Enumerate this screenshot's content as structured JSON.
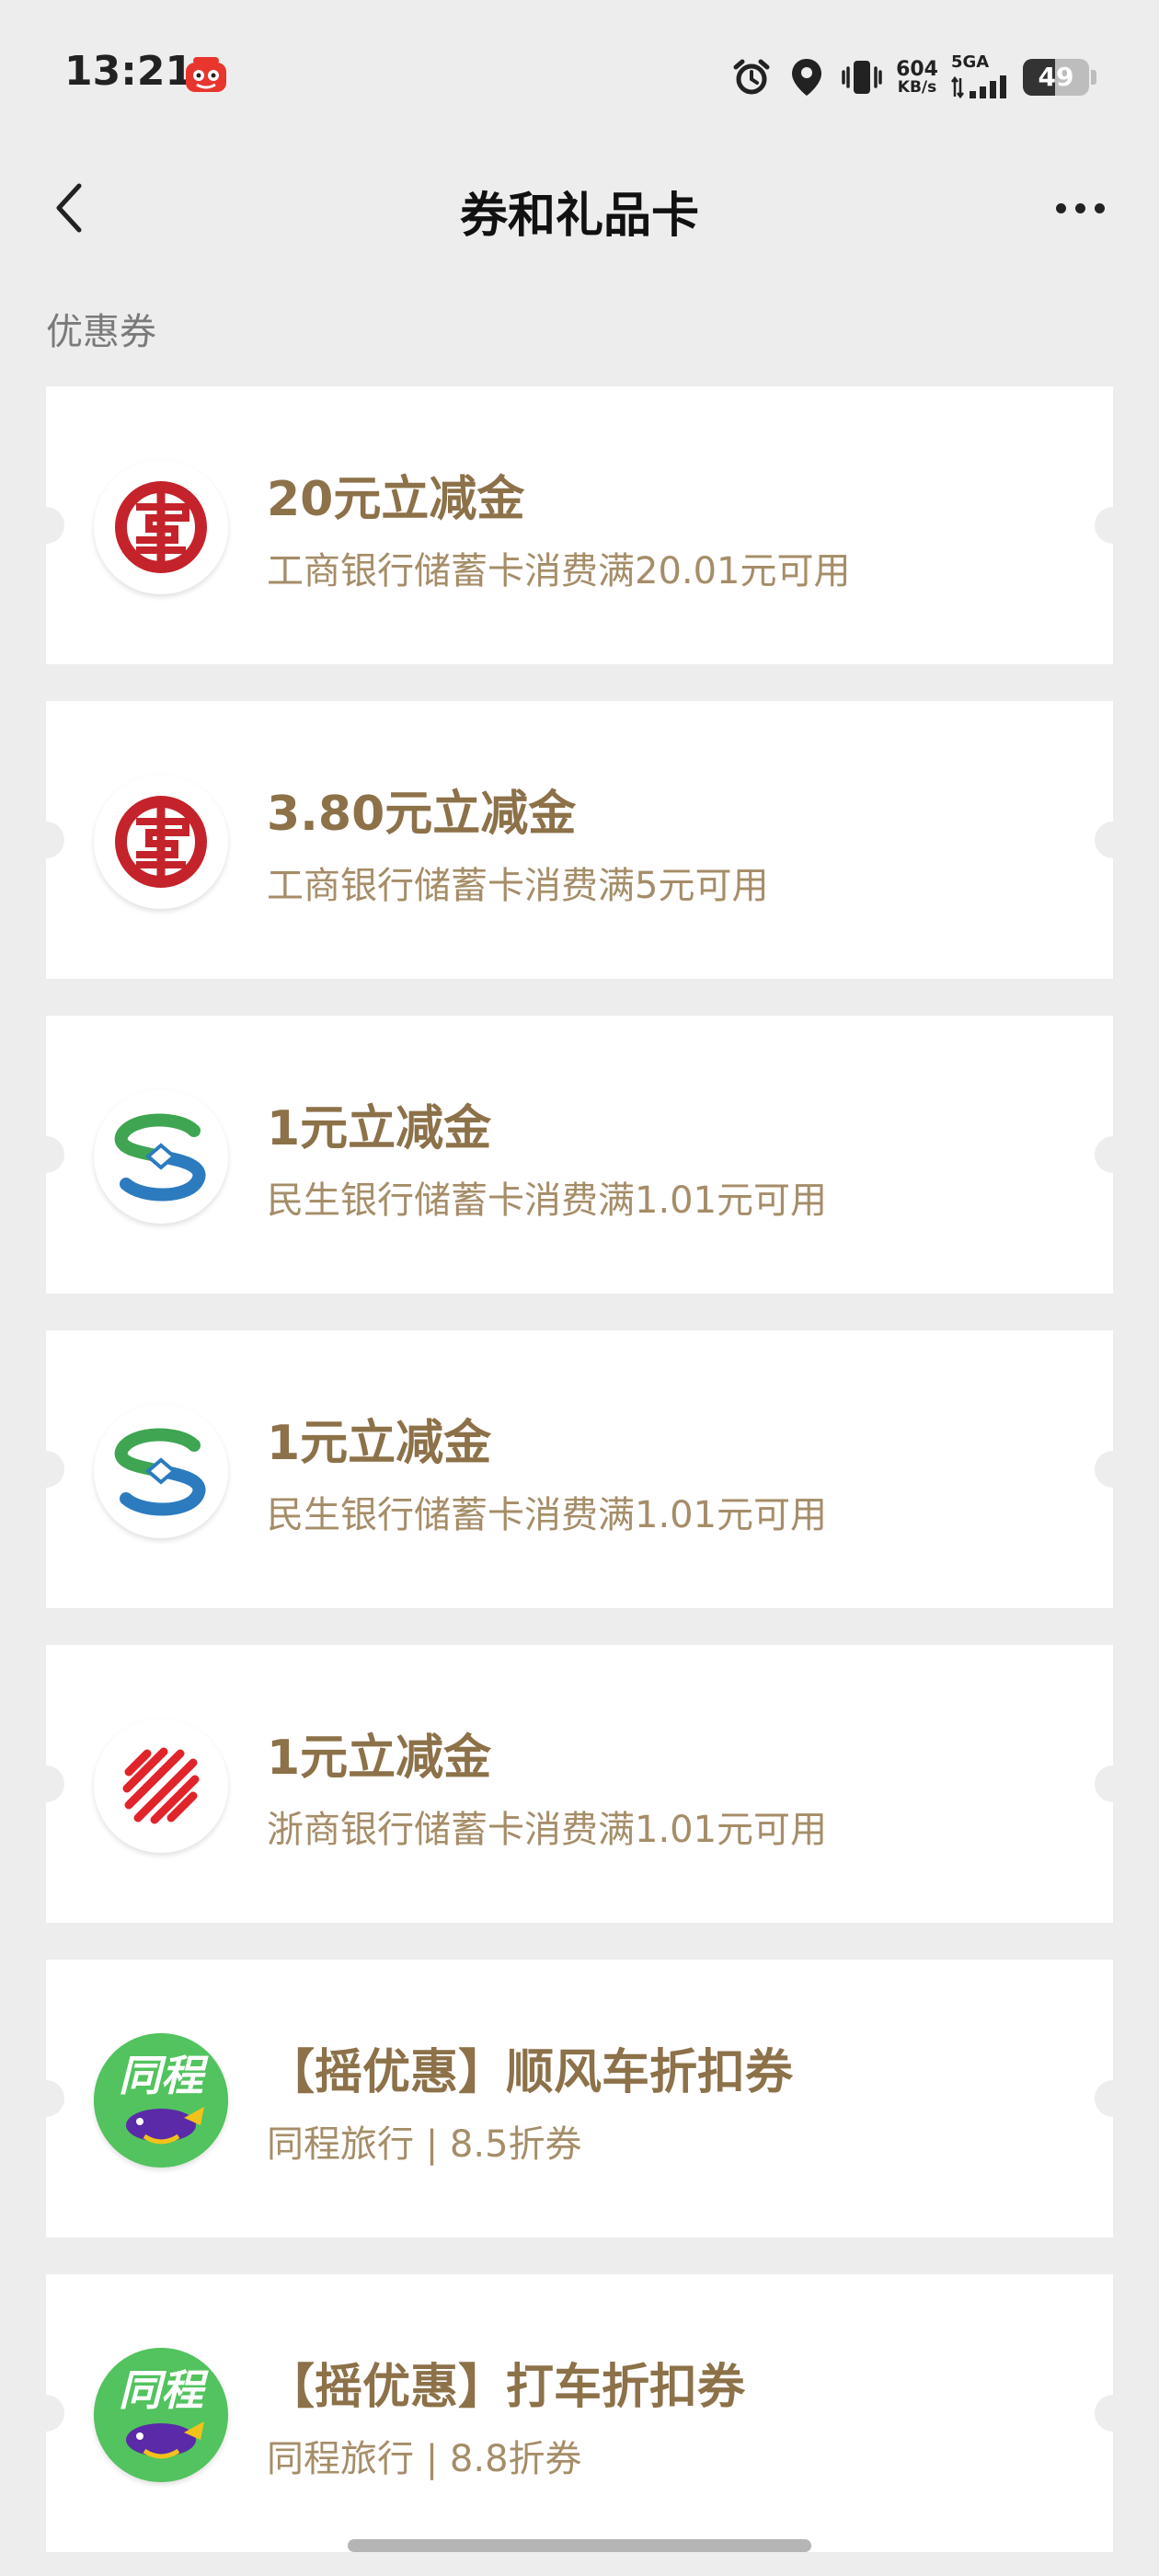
{
  "status_bar": {
    "time": "13:21",
    "net_speed_value": "604",
    "net_speed_unit": "KB/s",
    "signal_label": "5GA",
    "battery_level": "49",
    "battery_fraction": 0.49
  },
  "nav": {
    "title": "券和礼品卡"
  },
  "section": {
    "label": "优惠券"
  },
  "colors": {
    "coupon_title": "#8c7149",
    "coupon_desc": "#a58d68",
    "icbc_red": "#c4232b",
    "cmbc_green": "#3fa552",
    "cmbc_blue": "#2c7bbf",
    "czbank_red": "#e0242a",
    "tongcheng_green": "#52c35e"
  },
  "coupons": [
    {
      "title": "20元立减金",
      "desc": "工商银行储蓄卡消费满20.01元可用",
      "logo": "icbc-logo-icon"
    },
    {
      "title": "3.80元立减金",
      "desc": "工商银行储蓄卡消费满5元可用",
      "logo": "icbc-logo-icon"
    },
    {
      "title": "1元立减金",
      "desc": "民生银行储蓄卡消费满1.01元可用",
      "logo": "cmbc-logo-icon"
    },
    {
      "title": "1元立减金",
      "desc": "民生银行储蓄卡消费满1.01元可用",
      "logo": "cmbc-logo-icon"
    },
    {
      "title": "1元立减金",
      "desc": "浙商银行储蓄卡消费满1.01元可用",
      "logo": "czbank-logo-icon"
    },
    {
      "title": "【摇优惠】顺风车折扣券",
      "desc": "同程旅行 | 8.5折券",
      "logo": "tongcheng-logo-icon",
      "logo_text": "同程"
    },
    {
      "title": "【摇优惠】打车折扣券",
      "desc": "同程旅行 | 8.8折券",
      "logo": "tongcheng-logo-icon",
      "logo_text": "同程"
    }
  ]
}
